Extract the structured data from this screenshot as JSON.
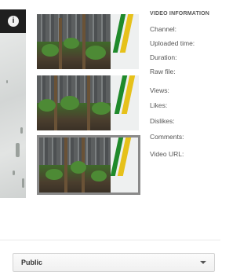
{
  "preview": {
    "info_icon_glyph": "i"
  },
  "thumbnails": [
    {
      "selected": false
    },
    {
      "selected": false
    },
    {
      "selected": true
    }
  ],
  "video_info": {
    "heading": "VIDEO INFORMATION",
    "labels": {
      "channel": "Channel:",
      "uploaded_time": "Uploaded time:",
      "duration": "Duration:",
      "raw_file": "Raw file:",
      "views": "Views:",
      "likes": "Likes:",
      "dislikes": "Dislikes:",
      "comments": "Comments:",
      "video_url": "Video URL:"
    }
  },
  "privacy": {
    "selected": "Public"
  }
}
